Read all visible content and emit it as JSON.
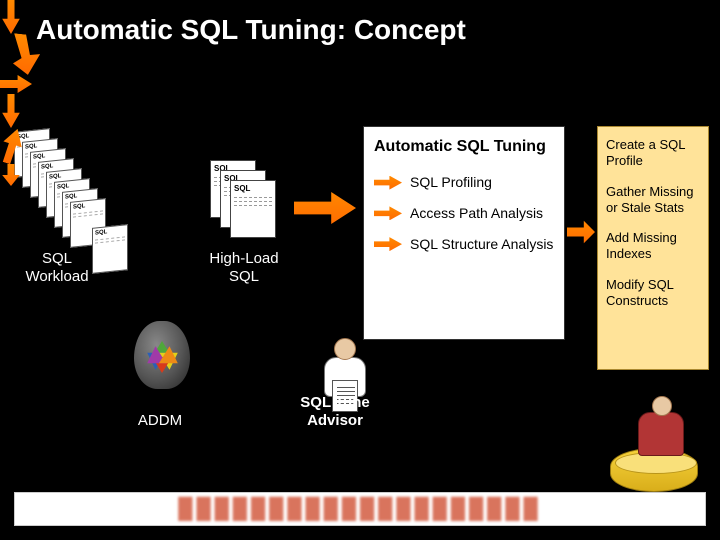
{
  "title": "Automatic SQL Tuning: Concept",
  "sql_card_header": "SQL",
  "workload": {
    "label": "SQL\nWorkload"
  },
  "highload": {
    "label": "High-Load\nSQL"
  },
  "addm": {
    "label": "ADDM"
  },
  "advisor": {
    "label": "SQL Tune\nAdvisor"
  },
  "tuning_box": {
    "header": "Automatic SQL Tuning",
    "items": [
      "SQL Profiling",
      "Access Path Analysis",
      "SQL Structure Analysis"
    ]
  },
  "output_box": {
    "items": [
      "Create a SQL Profile",
      "Gather Missing or Stale Stats",
      "Add Missing Indexes",
      "Modify SQL Constructs"
    ]
  }
}
